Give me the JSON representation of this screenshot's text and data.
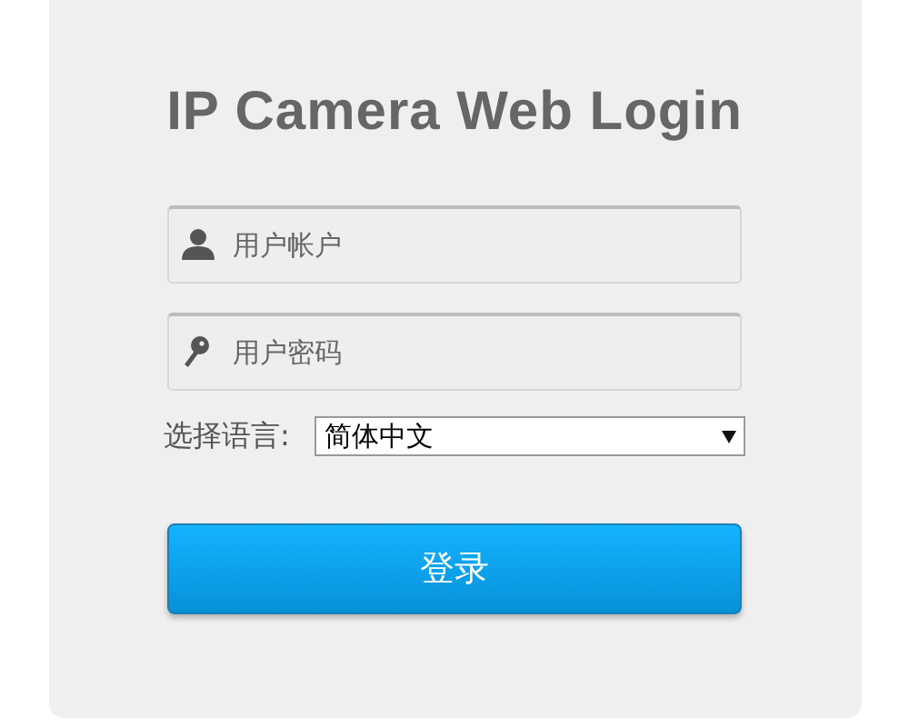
{
  "title": "IP Camera Web Login",
  "fields": [
    {
      "kind": "user",
      "placeholder": "用户帐户"
    },
    {
      "kind": "password",
      "placeholder": "用户密码"
    }
  ],
  "language": {
    "label": "选择语言:",
    "value": "简体中文"
  },
  "login_button": "登录"
}
